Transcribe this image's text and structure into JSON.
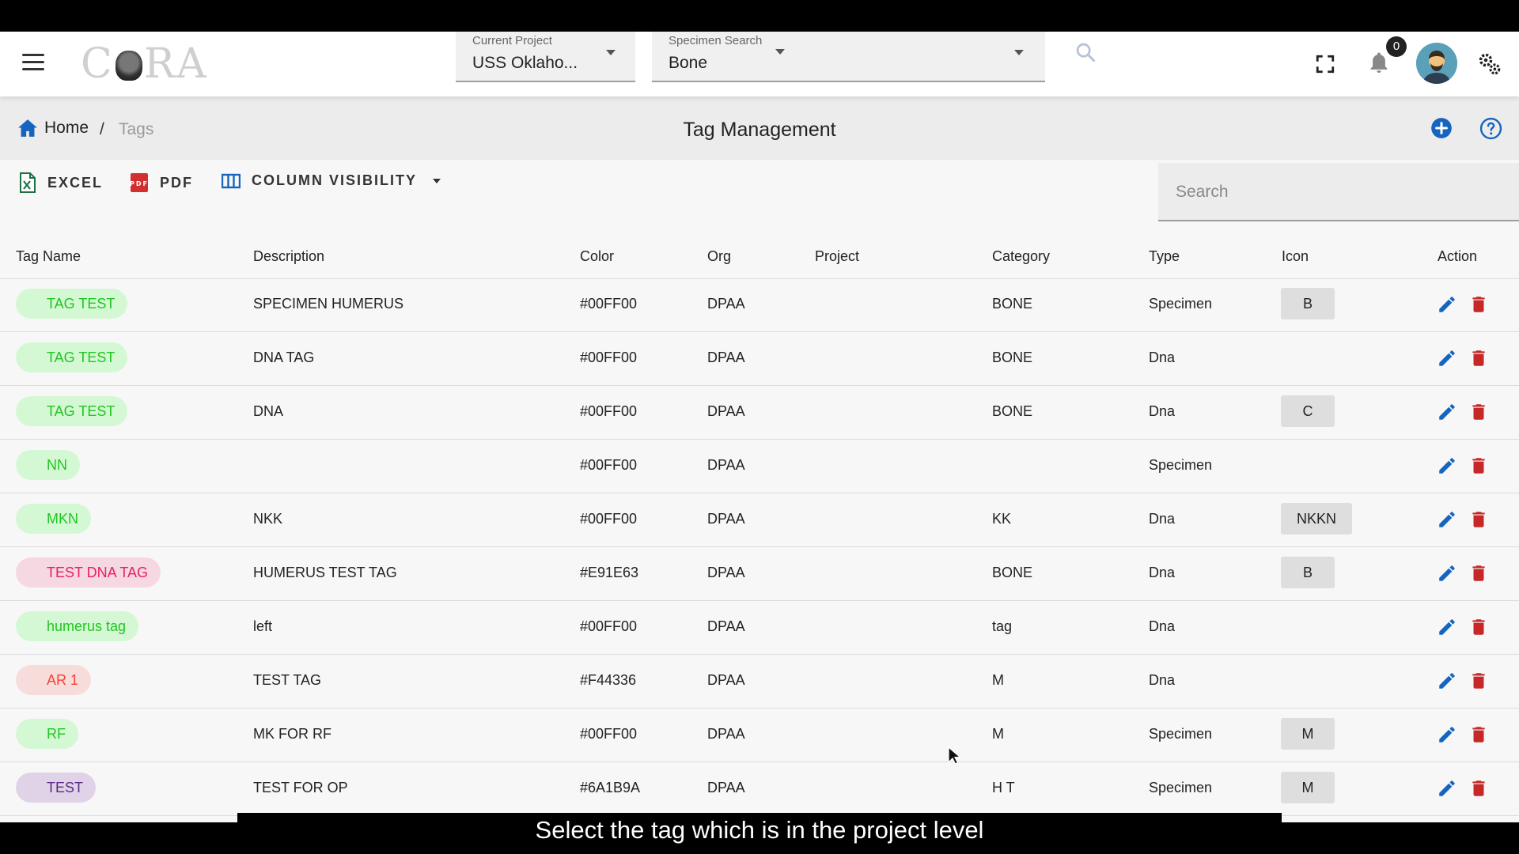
{
  "header": {
    "logo_text_left": "C",
    "logo_text_right": "RA",
    "project_label": "Current Project",
    "project_value": "USS Oklaho...",
    "specimen_label": "Specimen Search",
    "specimen_value": "Bone",
    "notification_count": "0"
  },
  "breadcrumb": {
    "home": "Home",
    "separator": "/",
    "current": "Tags"
  },
  "page": {
    "title": "Tag Management"
  },
  "toolbar": {
    "excel": "EXCEL",
    "pdf": "PDF",
    "column_visibility": "COLUMN VISIBILITY",
    "search_placeholder": "Search"
  },
  "table": {
    "headers": [
      "Tag Name",
      "Description",
      "Color",
      "Org",
      "Project",
      "Category",
      "Type",
      "Icon",
      "Action"
    ],
    "rows": [
      {
        "tag": "TAG TEST",
        "tag_color": "#00FF00",
        "description": "SPECIMEN HUMERUS",
        "color": "#00FF00",
        "org": "DPAA",
        "project": "",
        "category": "BONE",
        "type": "Specimen",
        "icon": "B"
      },
      {
        "tag": "TAG TEST",
        "tag_color": "#00FF00",
        "description": "DNA TAG",
        "color": "#00FF00",
        "org": "DPAA",
        "project": "",
        "category": "BONE",
        "type": "Dna",
        "icon": ""
      },
      {
        "tag": "TAG TEST",
        "tag_color": "#00FF00",
        "description": "DNA",
        "color": "#00FF00",
        "org": "DPAA",
        "project": "",
        "category": "BONE",
        "type": "Dna",
        "icon": "C"
      },
      {
        "tag": "NN",
        "tag_color": "#00FF00",
        "description": "",
        "color": "#00FF00",
        "org": "DPAA",
        "project": "",
        "category": "",
        "type": "Specimen",
        "icon": ""
      },
      {
        "tag": "MKN",
        "tag_color": "#00FF00",
        "description": "NKK",
        "color": "#00FF00",
        "org": "DPAA",
        "project": "",
        "category": "KK",
        "type": "Dna",
        "icon": "NKKN"
      },
      {
        "tag": "TEST DNA TAG",
        "tag_color": "#E91E63",
        "description": "HUMERUS TEST TAG",
        "color": "#E91E63",
        "org": "DPAA",
        "project": "",
        "category": "BONE",
        "type": "Dna",
        "icon": "B"
      },
      {
        "tag": "humerus tag",
        "tag_color": "#00FF00",
        "description": "left",
        "color": "#00FF00",
        "org": "DPAA",
        "project": "",
        "category": "tag",
        "type": "Dna",
        "icon": ""
      },
      {
        "tag": "AR 1",
        "tag_color": "#F44336",
        "description": "TEST TAG",
        "color": "#F44336",
        "org": "DPAA",
        "project": "",
        "category": "M",
        "type": "Dna",
        "icon": ""
      },
      {
        "tag": "RF",
        "tag_color": "#00FF00",
        "description": "MK FOR RF",
        "color": "#00FF00",
        "org": "DPAA",
        "project": "",
        "category": "M",
        "type": "Specimen",
        "icon": "M"
      },
      {
        "tag": "TEST",
        "tag_color": "#6A1B9A",
        "description": "TEST FOR OP",
        "color": "#6A1B9A",
        "org": "DPAA",
        "project": "",
        "category": "H T",
        "type": "Specimen",
        "icon": "M"
      }
    ]
  },
  "colors": {
    "accent_blue": "#1565C0",
    "delete_red": "#C62828",
    "excel_green": "#1E7145",
    "pdf_red": "#D32F2F"
  },
  "caption": "Select the tag which is in the project level"
}
